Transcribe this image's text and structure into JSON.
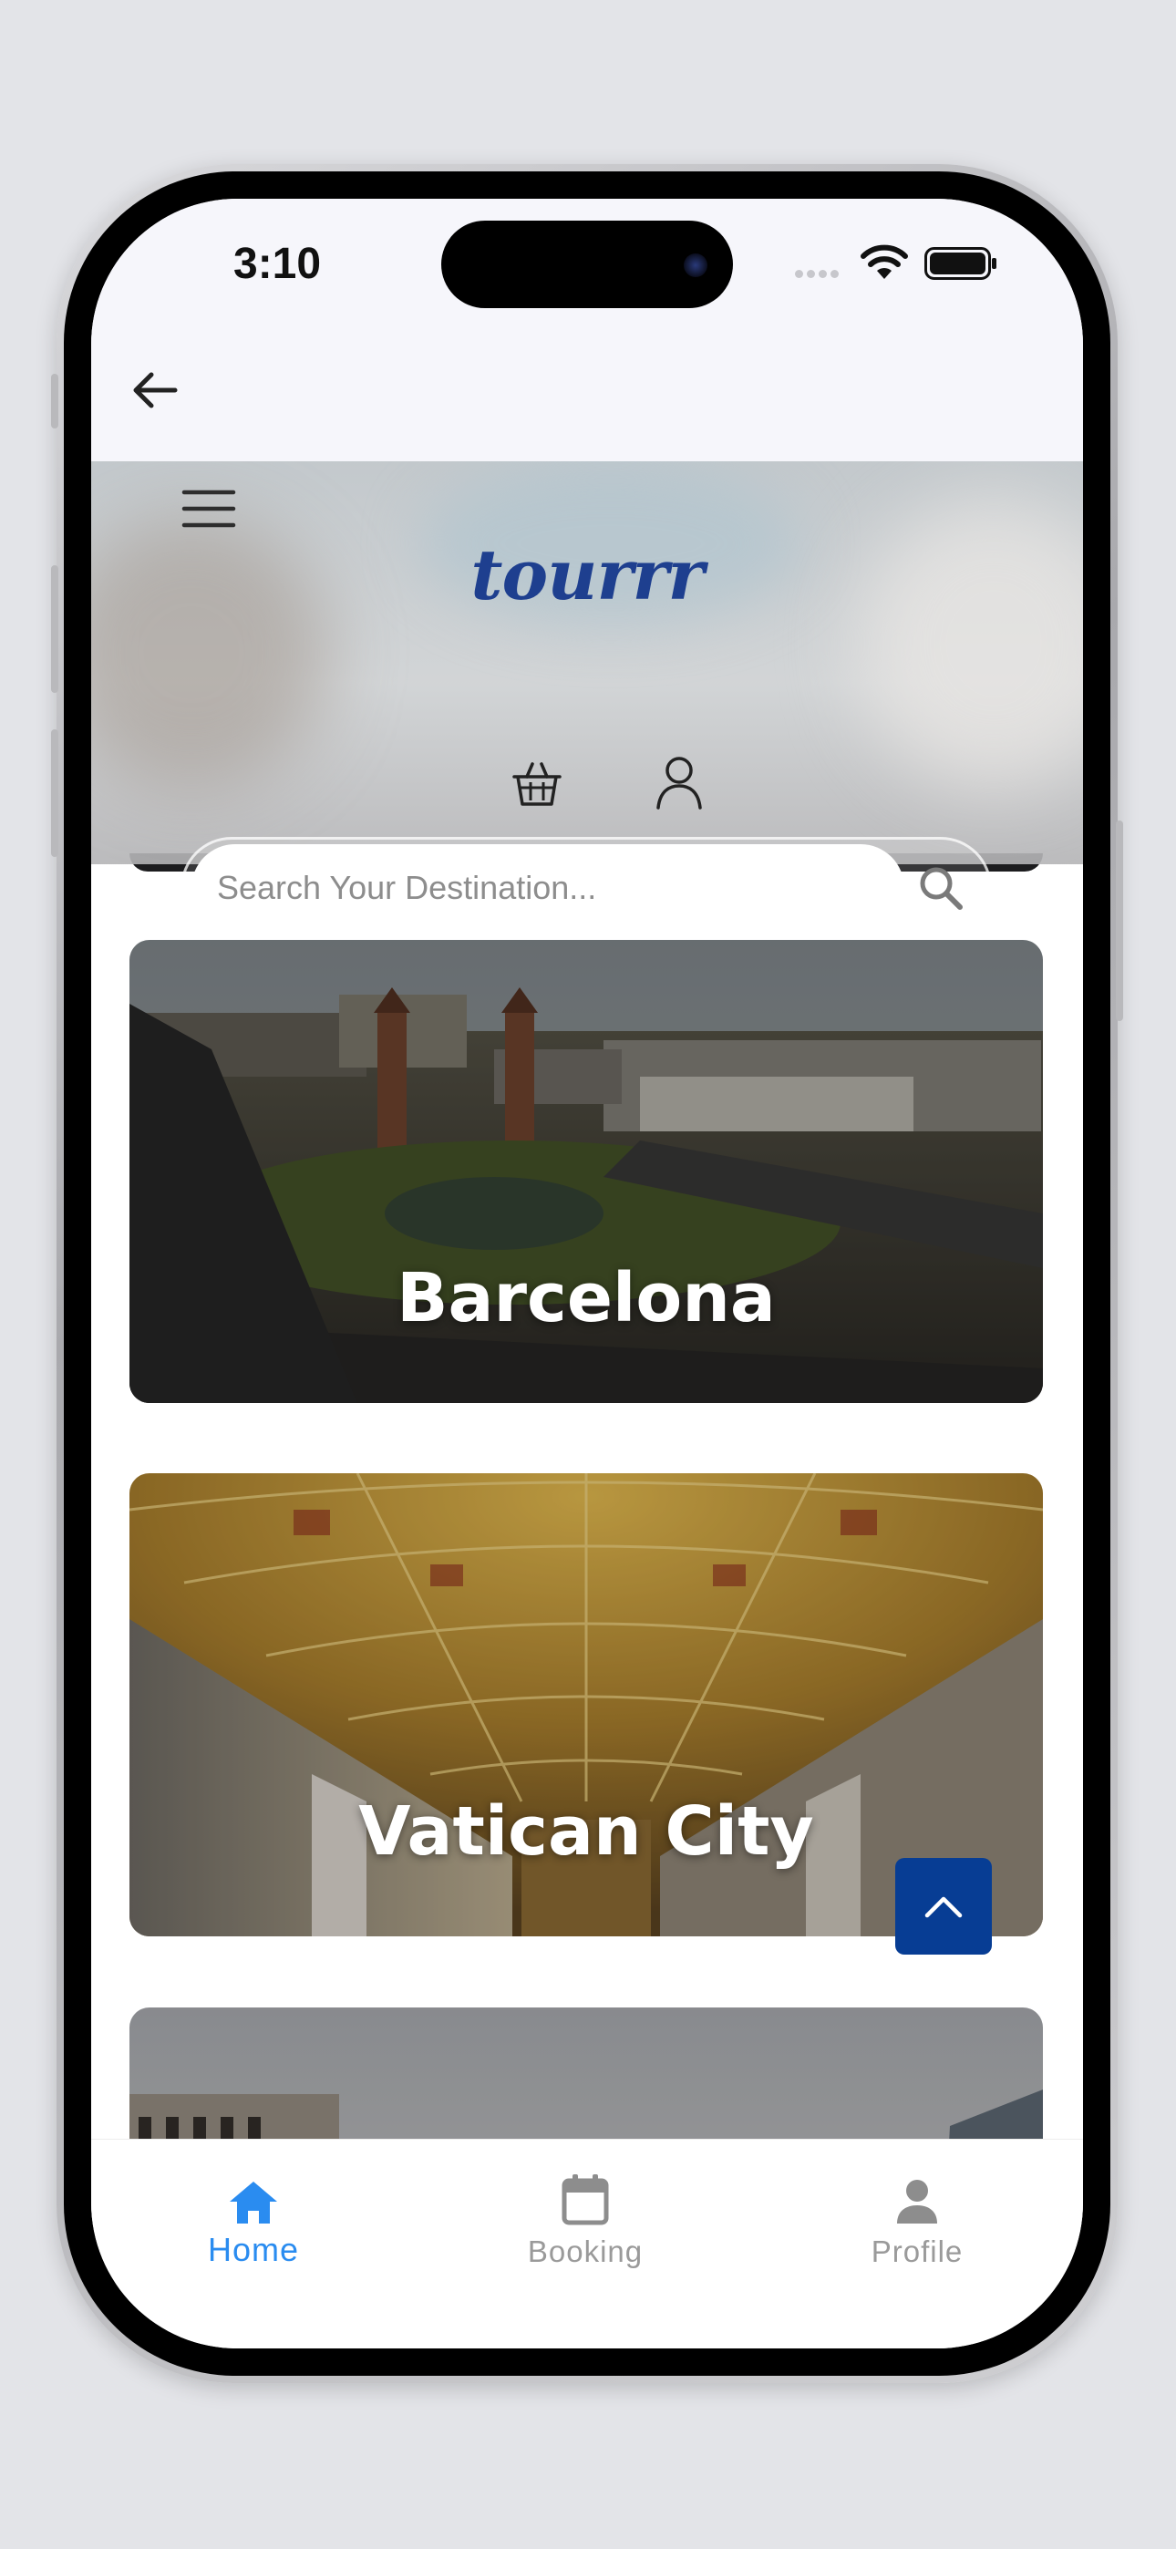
{
  "status_bar": {
    "time": "3:10"
  },
  "header": {
    "logo": "tourrr",
    "search": {
      "placeholder": "Search Your Destination...",
      "value": ""
    }
  },
  "destinations": [
    {
      "name": "Barcelona"
    },
    {
      "name": "Vatican City"
    },
    {
      "name": ""
    }
  ],
  "bottom_nav": {
    "active": "Home",
    "items": [
      {
        "label": "Home",
        "icon": "home-icon"
      },
      {
        "label": "Booking",
        "icon": "calendar-icon"
      },
      {
        "label": "Profile",
        "icon": "person-icon"
      }
    ]
  },
  "colors": {
    "brand_blue": "#1e3f8f",
    "accent_blue": "#2a8cf0",
    "scroll_button": "#073d94",
    "inactive_gray": "#9a9a9a"
  }
}
